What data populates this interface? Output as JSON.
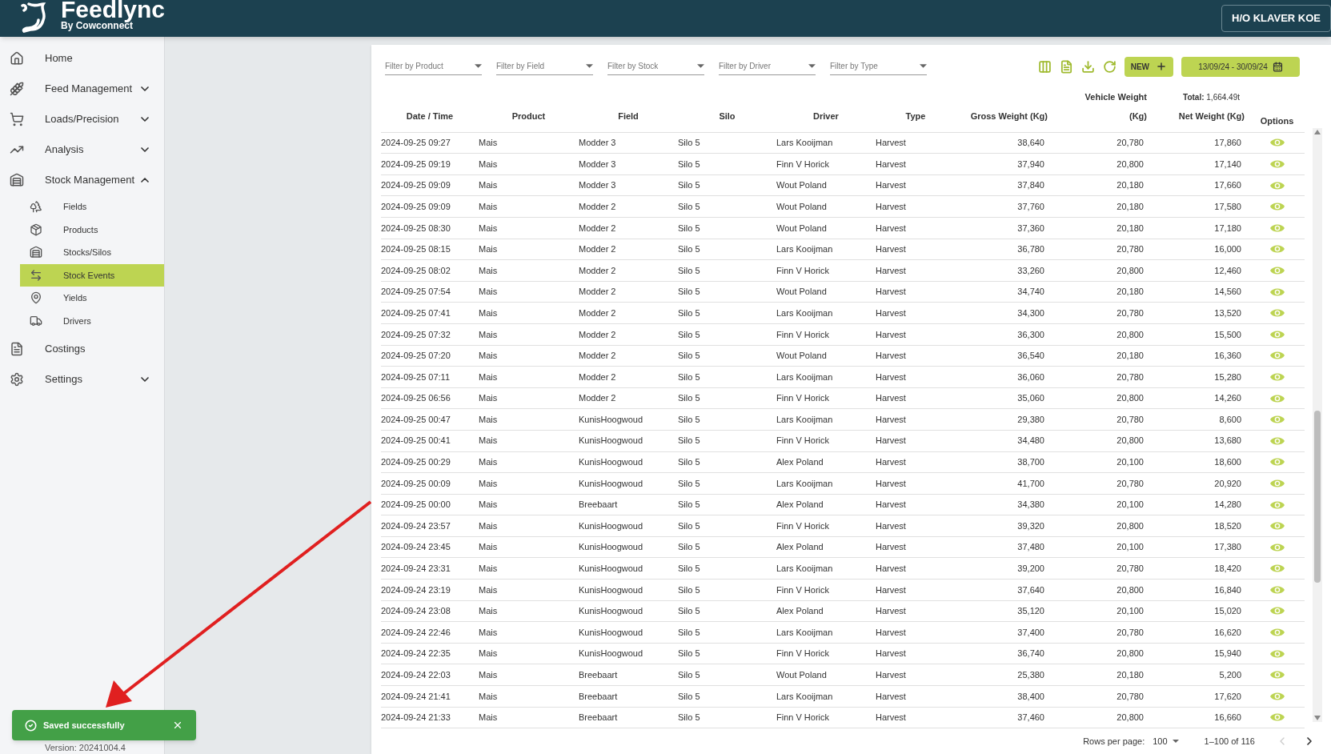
{
  "header": {
    "logo_title": "Feedlync",
    "logo_subtitle": "By Cowconnect",
    "account": "H/O KLAVER KOE"
  },
  "sidebar": {
    "items": [
      {
        "label": "Home",
        "selected": false
      },
      {
        "label": "Feed Management",
        "selected": false,
        "expanded": false
      },
      {
        "label": "Loads/Precision",
        "selected": false,
        "expanded": false
      },
      {
        "label": "Analysis",
        "selected": false,
        "expanded": false
      },
      {
        "label": "Stock Management",
        "selected": false,
        "expanded": true,
        "children": [
          {
            "label": "Fields",
            "selected": false
          },
          {
            "label": "Products",
            "selected": false
          },
          {
            "label": "Stocks/Silos",
            "selected": false
          },
          {
            "label": "Stock Events",
            "selected": true
          },
          {
            "label": "Yields",
            "selected": false
          },
          {
            "label": "Drivers",
            "selected": false
          }
        ]
      },
      {
        "label": "Costings",
        "selected": false
      },
      {
        "label": "Settings",
        "selected": false,
        "expanded": false
      }
    ],
    "version": "Version: 20241004.4"
  },
  "filters": [
    {
      "placeholder": "Filter by Product"
    },
    {
      "placeholder": "Filter by Field"
    },
    {
      "placeholder": "Filter by Stock"
    },
    {
      "placeholder": "Filter by Driver"
    },
    {
      "placeholder": "Filter by Type"
    }
  ],
  "toolbar": {
    "new_button": "NEW",
    "date_range": "13/09/24 - 30/09/24"
  },
  "table": {
    "columns": [
      {
        "label": "Date / Time",
        "kind": "text"
      },
      {
        "label": "Product",
        "kind": "text"
      },
      {
        "label": "Field",
        "kind": "text"
      },
      {
        "label": "Silo",
        "kind": "text"
      },
      {
        "label": "Driver",
        "kind": "text"
      },
      {
        "label": "Type",
        "kind": "text"
      },
      {
        "label": "Gross Weight (Kg)",
        "kind": "number"
      },
      {
        "label": "Vehicle Weight (Kg)",
        "kind": "number"
      },
      {
        "label": "Net Weight (Kg)",
        "kind": "number",
        "total": "**Total:** 1,664.49t"
      },
      {
        "label": "Options",
        "kind": "text"
      }
    ],
    "rows": [
      {
        "cells": [
          "2024-09-25 09:27",
          "Mais",
          "Modder 3",
          "Silo 5",
          "Lars Kooijman",
          "Harvest",
          "38,640",
          "20,780",
          "17,860"
        ]
      },
      {
        "cells": [
          "2024-09-25 09:19",
          "Mais",
          "Modder 3",
          "Silo 5",
          "Finn V Horick",
          "Harvest",
          "37,940",
          "20,800",
          "17,140"
        ]
      },
      {
        "cells": [
          "2024-09-25 09:09",
          "Mais",
          "Modder 3",
          "Silo 5",
          "Wout Poland",
          "Harvest",
          "37,840",
          "20,180",
          "17,660"
        ]
      },
      {
        "cells": [
          "2024-09-25 09:09",
          "Mais",
          "Modder 2",
          "Silo 5",
          "Wout Poland",
          "Harvest",
          "37,760",
          "20,180",
          "17,580"
        ]
      },
      {
        "cells": [
          "2024-09-25 08:30",
          "Mais",
          "Modder 2",
          "Silo 5",
          "Wout Poland",
          "Harvest",
          "37,360",
          "20,180",
          "17,180"
        ]
      },
      {
        "cells": [
          "2024-09-25 08:15",
          "Mais",
          "Modder 2",
          "Silo 5",
          "Lars Kooijman",
          "Harvest",
          "36,780",
          "20,780",
          "16,000"
        ]
      },
      {
        "cells": [
          "2024-09-25 08:02",
          "Mais",
          "Modder 2",
          "Silo 5",
          "Finn V Horick",
          "Harvest",
          "33,260",
          "20,800",
          "12,460"
        ]
      },
      {
        "cells": [
          "2024-09-25 07:54",
          "Mais",
          "Modder 2",
          "Silo 5",
          "Wout Poland",
          "Harvest",
          "34,740",
          "20,180",
          "14,560"
        ]
      },
      {
        "cells": [
          "2024-09-25 07:41",
          "Mais",
          "Modder 2",
          "Silo 5",
          "Lars Kooijman",
          "Harvest",
          "34,300",
          "20,780",
          "13,520"
        ]
      },
      {
        "cells": [
          "2024-09-25 07:32",
          "Mais",
          "Modder 2",
          "Silo 5",
          "Finn V Horick",
          "Harvest",
          "36,300",
          "20,800",
          "15,500"
        ]
      },
      {
        "cells": [
          "2024-09-25 07:20",
          "Mais",
          "Modder 2",
          "Silo 5",
          "Wout Poland",
          "Harvest",
          "36,540",
          "20,180",
          "16,360"
        ]
      },
      {
        "cells": [
          "2024-09-25 07:11",
          "Mais",
          "Modder 2",
          "Silo 5",
          "Lars Kooijman",
          "Harvest",
          "36,060",
          "20,780",
          "15,280"
        ]
      },
      {
        "cells": [
          "2024-09-25 06:56",
          "Mais",
          "Modder 2",
          "Silo 5",
          "Finn V Horick",
          "Harvest",
          "35,060",
          "20,800",
          "14,260"
        ]
      },
      {
        "cells": [
          "2024-09-25 00:47",
          "Mais",
          "KunisHoogwoud",
          "Silo 5",
          "Lars Kooijman",
          "Harvest",
          "29,380",
          "20,780",
          "8,600"
        ]
      },
      {
        "cells": [
          "2024-09-25 00:41",
          "Mais",
          "KunisHoogwoud",
          "Silo 5",
          "Finn V Horick",
          "Harvest",
          "34,480",
          "20,800",
          "13,680"
        ]
      },
      {
        "cells": [
          "2024-09-25 00:29",
          "Mais",
          "KunisHoogwoud",
          "Silo 5",
          "Alex Poland",
          "Harvest",
          "38,700",
          "20,100",
          "18,600"
        ]
      },
      {
        "cells": [
          "2024-09-25 00:09",
          "Mais",
          "KunisHoogwoud",
          "Silo 5",
          "Lars Kooijman",
          "Harvest",
          "41,700",
          "20,780",
          "20,920"
        ]
      },
      {
        "cells": [
          "2024-09-25 00:00",
          "Mais",
          "Breebaart",
          "Silo 5",
          "Alex Poland",
          "Harvest",
          "34,380",
          "20,100",
          "14,280"
        ]
      },
      {
        "cells": [
          "2024-09-24 23:57",
          "Mais",
          "KunisHoogwoud",
          "Silo 5",
          "Finn V Horick",
          "Harvest",
          "39,320",
          "20,800",
          "18,520"
        ]
      },
      {
        "cells": [
          "2024-09-24 23:45",
          "Mais",
          "KunisHoogwoud",
          "Silo 5",
          "Alex Poland",
          "Harvest",
          "37,480",
          "20,100",
          "17,380"
        ]
      },
      {
        "cells": [
          "2024-09-24 23:31",
          "Mais",
          "KunisHoogwoud",
          "Silo 5",
          "Lars Kooijman",
          "Harvest",
          "39,200",
          "20,780",
          "18,420"
        ]
      },
      {
        "cells": [
          "2024-09-24 23:19",
          "Mais",
          "KunisHoogwoud",
          "Silo 5",
          "Finn V Horick",
          "Harvest",
          "37,640",
          "20,800",
          "16,840"
        ]
      },
      {
        "cells": [
          "2024-09-24 23:08",
          "Mais",
          "KunisHoogwoud",
          "Silo 5",
          "Alex Poland",
          "Harvest",
          "35,120",
          "20,100",
          "15,020"
        ]
      },
      {
        "cells": [
          "2024-09-24 22:46",
          "Mais",
          "KunisHoogwoud",
          "Silo 5",
          "Lars Kooijman",
          "Harvest",
          "37,400",
          "20,780",
          "16,620"
        ]
      },
      {
        "cells": [
          "2024-09-24 22:35",
          "Mais",
          "KunisHoogwoud",
          "Silo 5",
          "Finn V Horick",
          "Harvest",
          "36,740",
          "20,800",
          "15,940"
        ]
      },
      {
        "cells": [
          "2024-09-24 22:03",
          "Mais",
          "Breebaart",
          "Silo 5",
          "Wout Poland",
          "Harvest",
          "25,380",
          "20,180",
          "5,200"
        ]
      },
      {
        "cells": [
          "2024-09-24 21:41",
          "Mais",
          "Breebaart",
          "Silo 5",
          "Lars Kooijman",
          "Harvest",
          "38,400",
          "20,780",
          "17,620"
        ]
      },
      {
        "cells": [
          "2024-09-24 21:33",
          "Mais",
          "Breebaart",
          "Silo 5",
          "Finn V Horick",
          "Harvest",
          "37,460",
          "20,800",
          "16,660"
        ]
      }
    ]
  },
  "pagination": {
    "rows_label": "Rows per page:",
    "rows_value": "100",
    "range": "1–100 of 116",
    "prev_disabled": true,
    "next_disabled": false
  },
  "toast": {
    "message": "Saved successfully"
  }
}
